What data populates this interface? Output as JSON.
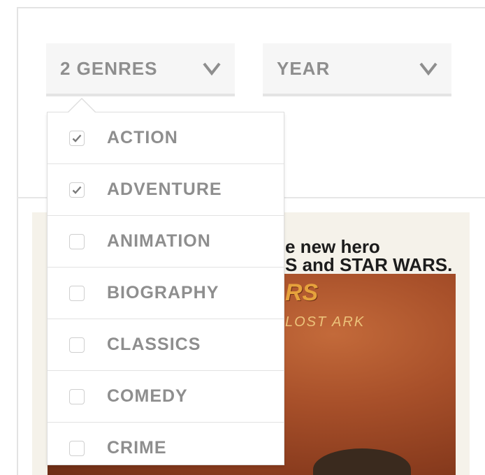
{
  "filters": {
    "genres": {
      "label": "2 GENRES",
      "icon": "chevron-down-icon"
    },
    "year": {
      "label": "YEAR",
      "icon": "chevron-down-icon"
    }
  },
  "genre_options": [
    {
      "label": "ACTION",
      "checked": true
    },
    {
      "label": "ADVENTURE",
      "checked": true
    },
    {
      "label": "ANIMATION",
      "checked": false
    },
    {
      "label": "BIOGRAPHY",
      "checked": false
    },
    {
      "label": "CLASSICS",
      "checked": false
    },
    {
      "label": "COMEDY",
      "checked": false
    },
    {
      "label": "CRIME",
      "checked": false
    }
  ],
  "poster": {
    "line1": "e new hero",
    "line2": "S and STAR WARS.",
    "title1": "RS",
    "title2": "LOST ARK"
  },
  "colors": {
    "text_muted": "#8e8e8e",
    "select_bg": "#f6f6f6",
    "check": "#7a7a7a"
  }
}
